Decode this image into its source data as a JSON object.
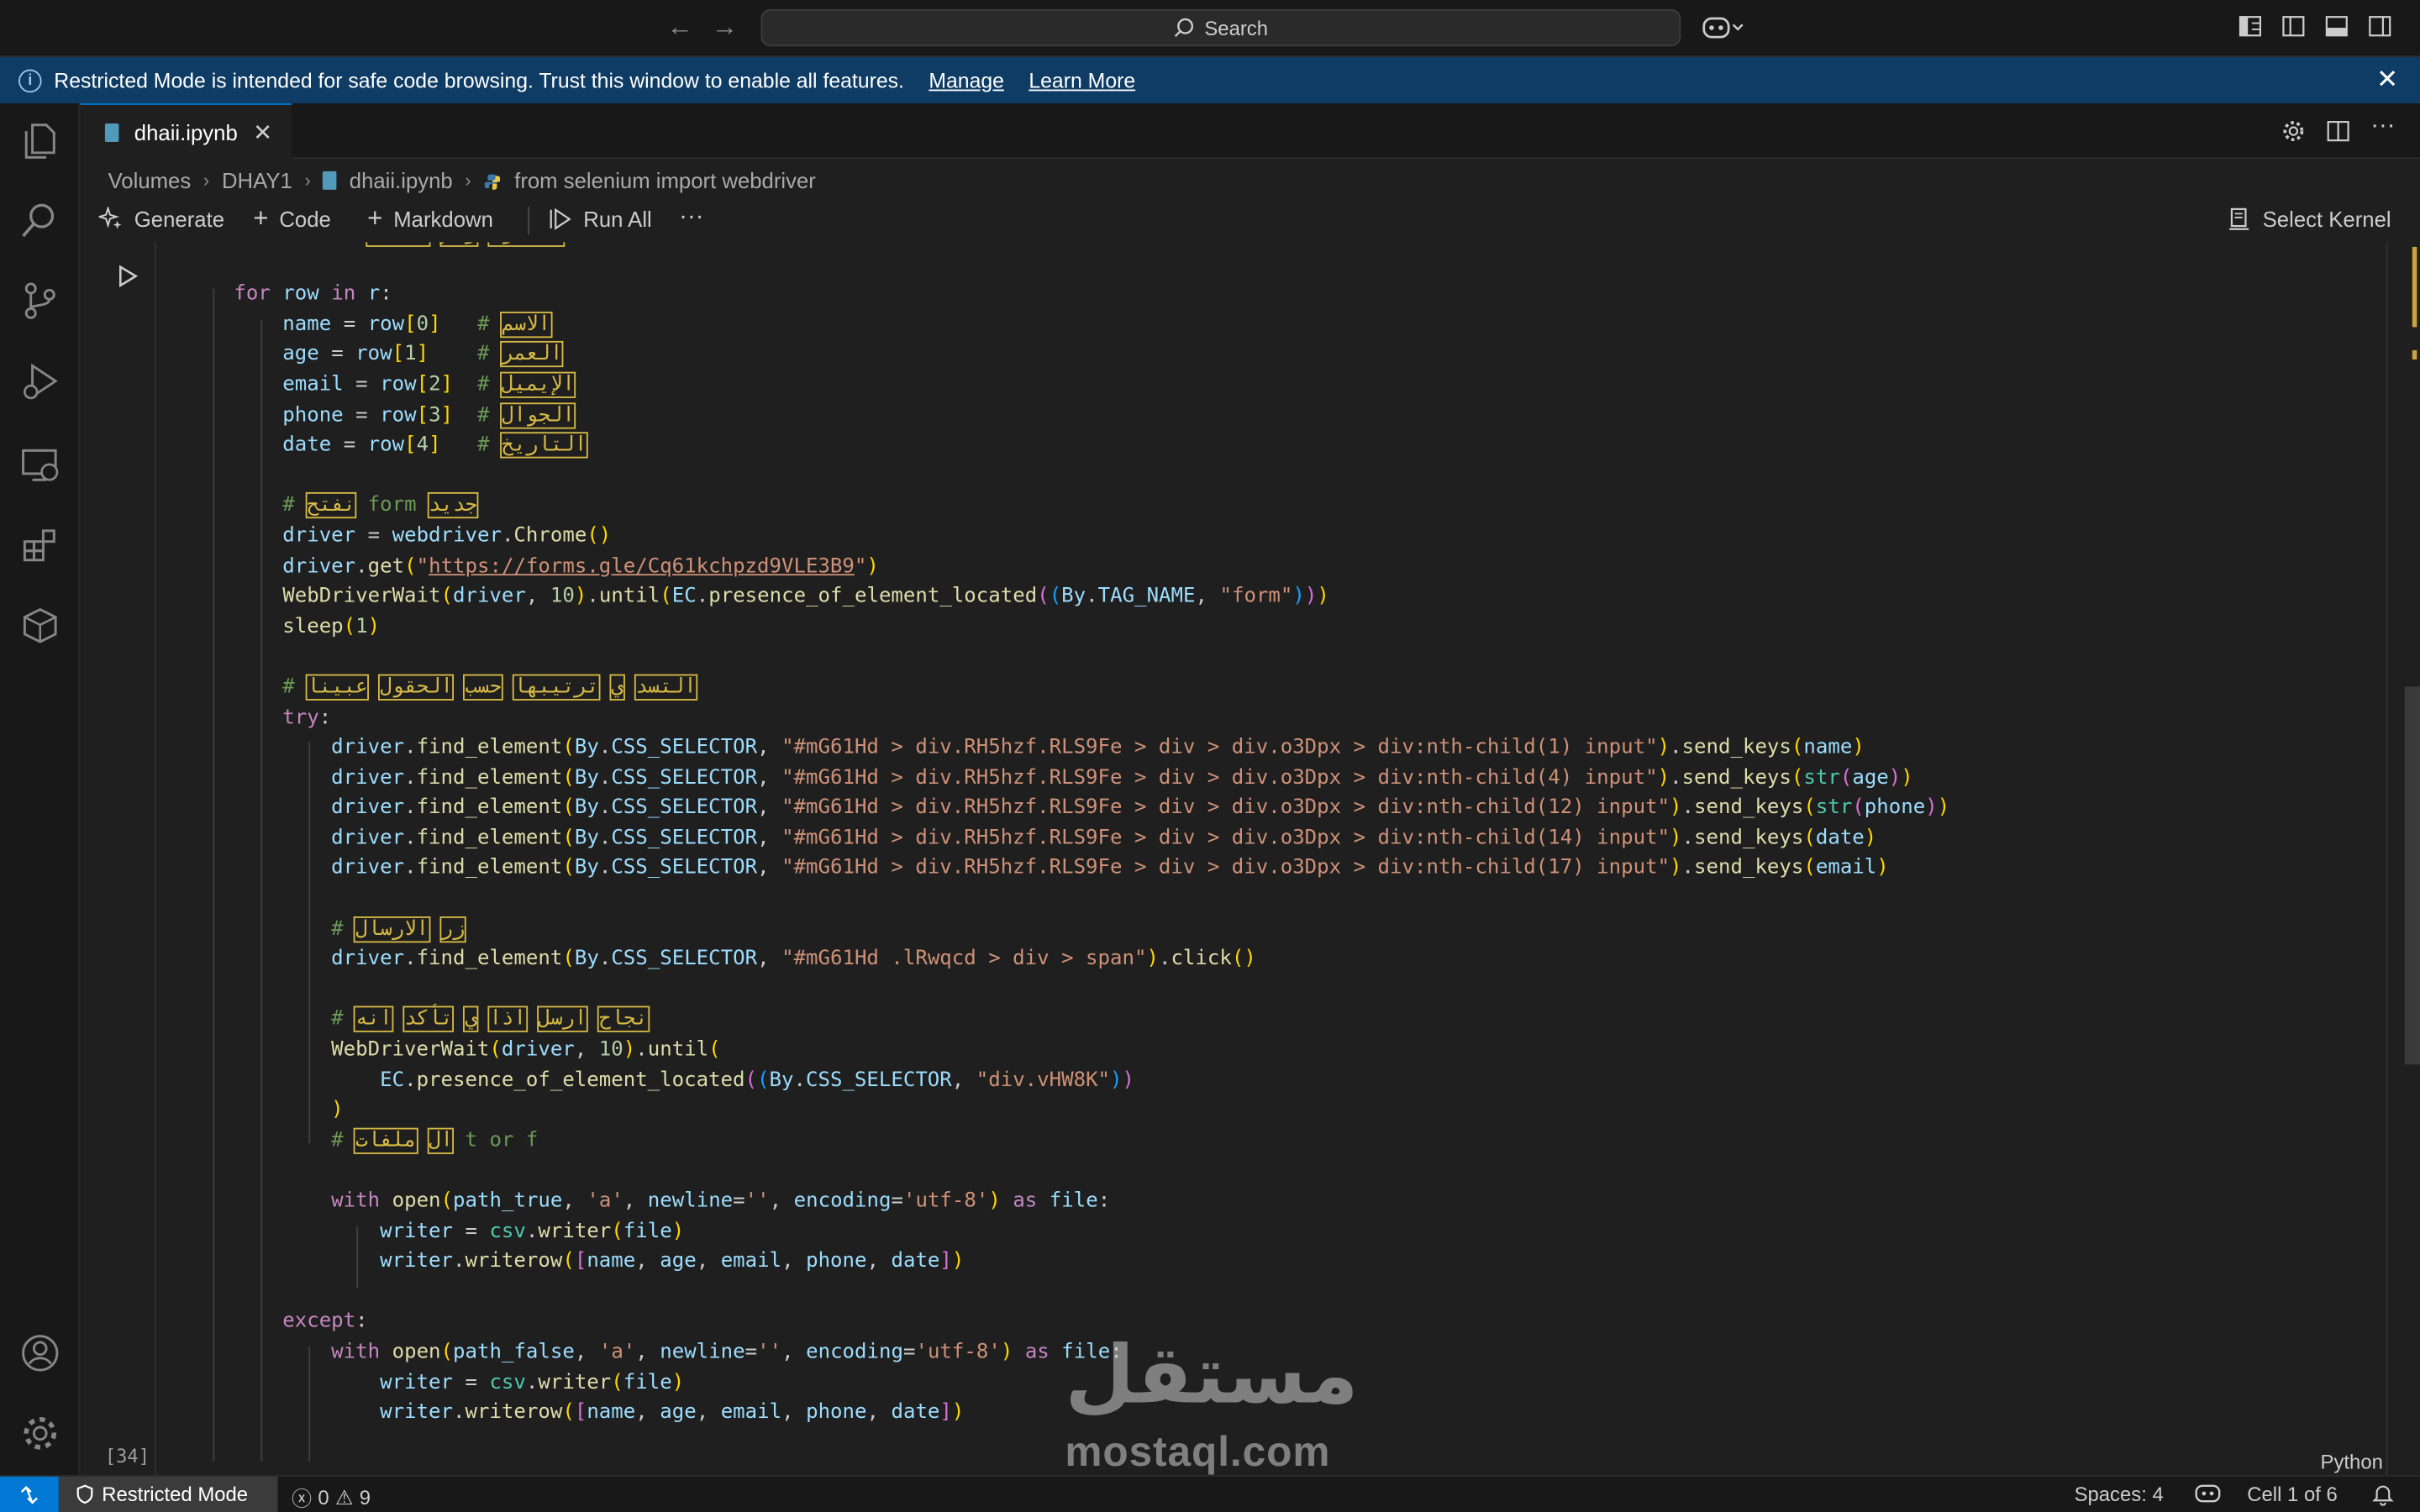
{
  "titlebar": {
    "search_label": "Search"
  },
  "banner": {
    "message": "Restricted Mode is intended for safe code browsing. Trust this window to enable all features.",
    "manage_link": "Manage",
    "learn_more_link": "Learn More"
  },
  "activity_bar": {
    "items": [
      "explorer-icon",
      "search-icon",
      "source-control-icon",
      "run-debug-icon",
      "remote-explorer-icon",
      "extensions-icon",
      "containers-icon"
    ],
    "bottom": [
      "accounts-icon",
      "settings-gear-icon"
    ]
  },
  "tab": {
    "filename": "dhaii.ipynb"
  },
  "breadcrumb": {
    "items": [
      "Volumes",
      "DHAY1",
      "dhaii.ipynb",
      "from selenium import webdriver"
    ]
  },
  "toolbar": {
    "generate": "Generate",
    "code": "Code",
    "markdown": "Markdown",
    "run_all": "Run All",
    "more": "···",
    "select_kernel": "Select Kernel"
  },
  "cell": {
    "execution_count": "[34]",
    "language": "Python"
  },
  "watermark": {
    "arabic": "مستقل",
    "latin": "mostaql.com"
  },
  "statusbar": {
    "restricted_mode": "Restricted Mode",
    "errors": "0",
    "warnings": "9",
    "spaces": "Spaces: 4",
    "cell_position": "Cell 1 of 6"
  },
  "colors": {
    "banner_bg": "#0e3c64",
    "accent": "#0078d4",
    "editor_bg": "#1f1f1f",
    "arabic_highlight": "#d7ba45"
  }
}
